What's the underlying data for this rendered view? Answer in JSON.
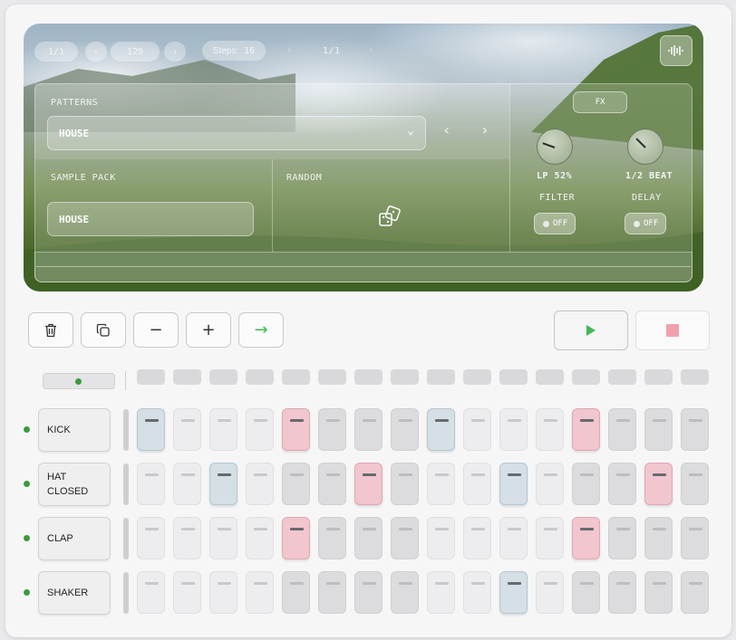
{
  "transport": {
    "measure": "1/1",
    "tempo": "120",
    "steps_label": "Steps:",
    "steps_value": "16",
    "page": "1/1"
  },
  "patterns": {
    "label": "PATTERNS",
    "selected": "HOUSE"
  },
  "sample_pack": {
    "label": "SAMPLE PACK",
    "selected": "HOUSE"
  },
  "random": {
    "label": "RANDOM"
  },
  "fx": {
    "label": "FX",
    "filter": {
      "value": "LP 52%",
      "label": "FILTER",
      "toggle": "OFF",
      "knob_level": 0.52
    },
    "delay": {
      "value": "1/2 BEAT",
      "label": "DELAY",
      "toggle": "OFF",
      "knob_level": 0.3
    }
  },
  "toolbar": {
    "delete_icon": "trash-icon",
    "copy_icon": "copy-icon",
    "minus_label": "−",
    "plus_label": "+",
    "arrow_label": "→"
  },
  "playback": {
    "play_icon": "play-icon",
    "stop_icon": "stop-icon",
    "accent_green": "#3fb950",
    "accent_red": "#f0a1ad"
  },
  "current_step": 1,
  "tracks": [
    {
      "name": "KICK",
      "steps": [
        "blue",
        "off",
        "off",
        "off",
        "pink",
        "off",
        "off",
        "off",
        "blue",
        "off",
        "off",
        "off",
        "pink",
        "off",
        "off",
        "off"
      ]
    },
    {
      "name": "HAT\nCLOSED",
      "steps": [
        "off",
        "off",
        "blue",
        "off",
        "off",
        "off",
        "pink",
        "off",
        "off",
        "off",
        "blue",
        "off",
        "off",
        "off",
        "pink",
        "off"
      ]
    },
    {
      "name": "CLAP",
      "steps": [
        "off",
        "off",
        "off",
        "off",
        "pink",
        "off",
        "off",
        "off",
        "off",
        "off",
        "off",
        "off",
        "pink",
        "off",
        "off",
        "off"
      ]
    },
    {
      "name": "SHAKER",
      "steps": [
        "off",
        "off",
        "off",
        "off",
        "off",
        "off",
        "off",
        "off",
        "off",
        "off",
        "blue",
        "off",
        "off",
        "off",
        "off",
        "off"
      ]
    }
  ]
}
